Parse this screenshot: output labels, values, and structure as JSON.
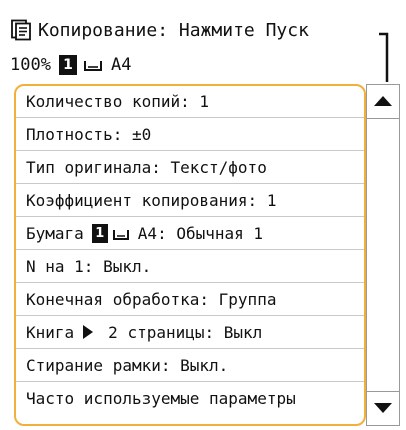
{
  "header": {
    "title": "Копирование: Нажмите Пуск",
    "zoom": "100%",
    "tray_number": "1",
    "paper_size": "A4",
    "icon": "copy-document-icon"
  },
  "list": {
    "items": [
      {
        "label": "Количество копий: 1"
      },
      {
        "label": "Плотность: ±0"
      },
      {
        "label": "Тип оригинала: Текст/фото"
      },
      {
        "label": "Коэффициент копирования: 1"
      },
      {
        "prefix": "Бумага",
        "tray": "1",
        "suffix": "A4: Обычная 1"
      },
      {
        "label": "N на 1: Выкл."
      },
      {
        "label": "Конечная обработка: Группа"
      },
      {
        "prefix": "Книга",
        "suffix": "2 страницы: Выкл"
      },
      {
        "label": "Стирание рамки: Выкл."
      },
      {
        "label": "Часто используемые параметры"
      }
    ]
  },
  "scrollbar": {
    "up_icon": "triangle-up-icon",
    "down_icon": "triangle-down-icon"
  },
  "colors": {
    "panel_border": "#f2b03a",
    "divider": "#c9c9c9",
    "text": "#111111"
  }
}
